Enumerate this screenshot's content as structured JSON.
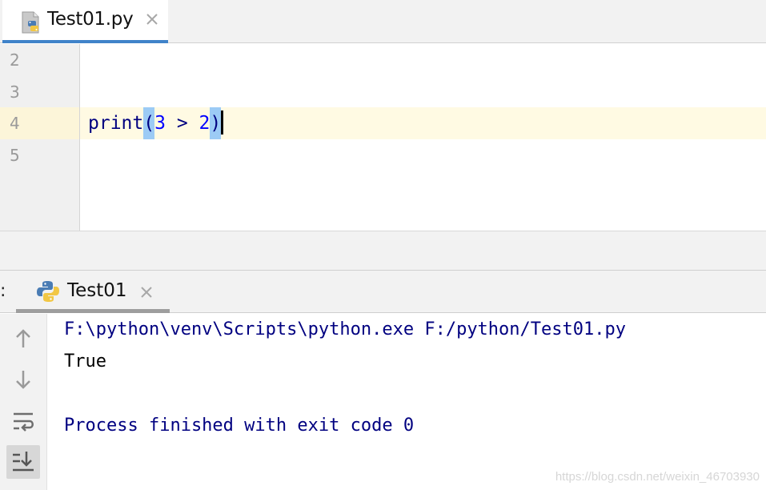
{
  "editor": {
    "tab": {
      "label": "Test01.py",
      "icon": "python-file-icon",
      "close_icon": "close-icon"
    },
    "line_numbers": [
      "2",
      "3",
      "4",
      "5"
    ],
    "current_line_number": "4",
    "code": {
      "func": "print",
      "open_paren": "(",
      "left_operand": "3",
      "operator": " > ",
      "right_operand": "2",
      "close_paren": ")"
    }
  },
  "run": {
    "prefix": ":",
    "tab": {
      "label": "Test01",
      "icon": "python-icon",
      "close_icon": "close-icon"
    },
    "toolbar": [
      "up-arrow-icon",
      "down-arrow-icon",
      "soft-wrap-icon",
      "scroll-to-end-icon"
    ],
    "console": {
      "command": "F:\\python\\venv\\Scripts\\python.exe F:/python/Test01.py",
      "output": "True",
      "exit_message": "Process finished with exit code 0"
    }
  },
  "watermark": "https://blog.csdn.net/weixin_46703930",
  "colors": {
    "tab_active_underline": "#4083c9",
    "current_line_bg": "#fffae3",
    "paren_match_bg": "#9ccbf5",
    "keyword_blue": "#000080",
    "number_blue": "#0000ff"
  }
}
